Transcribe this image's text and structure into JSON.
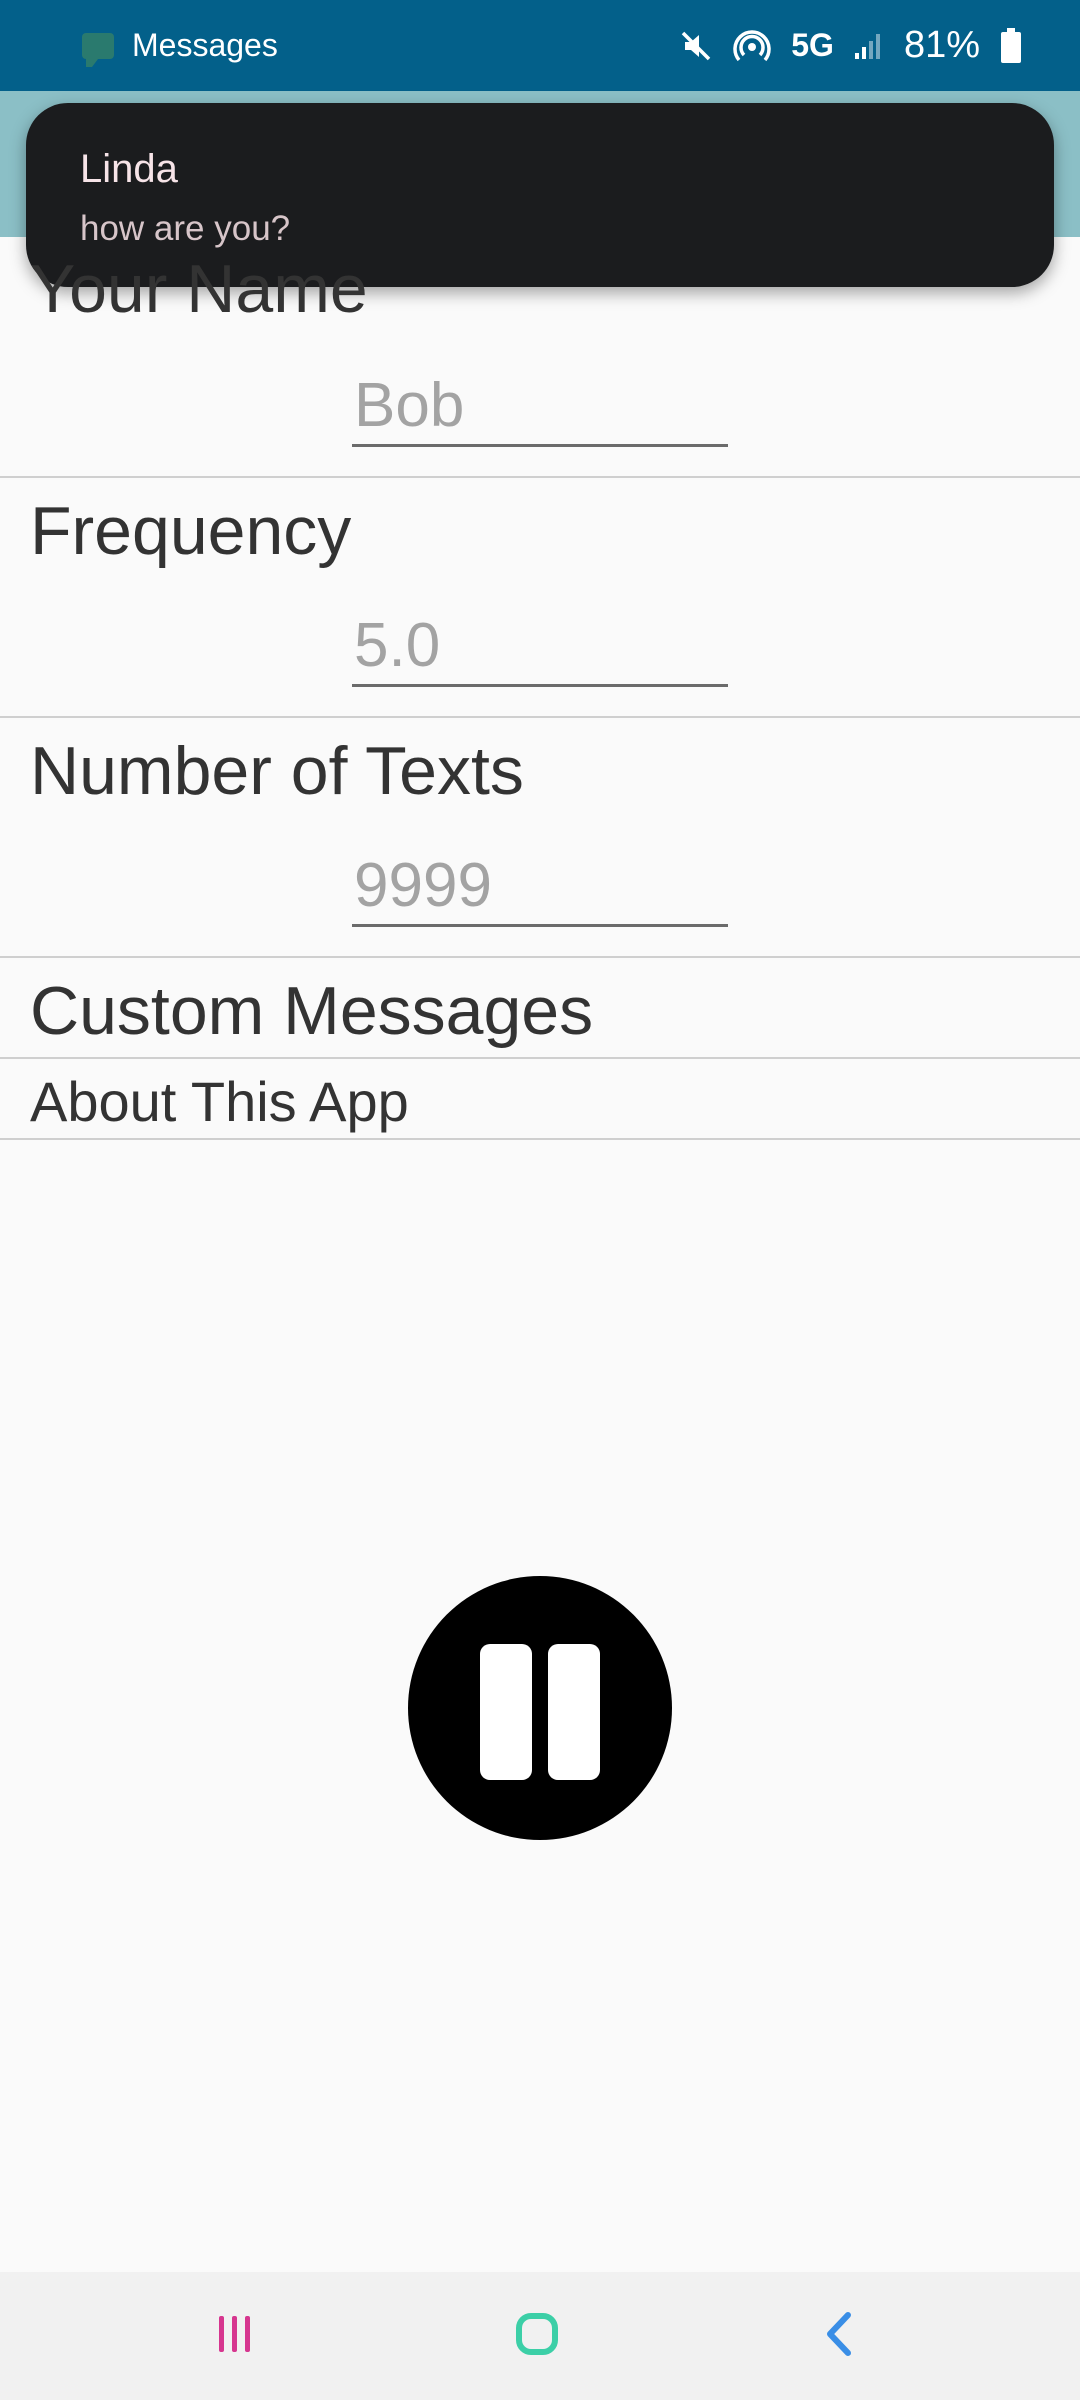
{
  "status_bar": {
    "app_label": "Messages",
    "network": "5G",
    "battery": "81%",
    "icons": [
      "messages-app-icon",
      "mute-icon",
      "hotspot-icon",
      "signal-icon",
      "battery-icon"
    ]
  },
  "notification": {
    "title": "Linda",
    "body": "how are you?"
  },
  "preferences": {
    "name": {
      "title": "Your Name",
      "placeholder": "Bob"
    },
    "frequency": {
      "title": "Frequency",
      "placeholder": "5.0"
    },
    "num_texts": {
      "title": "Number of Texts",
      "placeholder": "9999"
    },
    "custom_messages": {
      "title": "Custom Messages"
    },
    "about": {
      "title": "About This App"
    }
  },
  "controls": {
    "pause_icon": "pause-icon"
  },
  "nav": {
    "icons": [
      "recents-icon",
      "home-icon",
      "back-icon"
    ]
  },
  "colors": {
    "status_bar": "#03608a",
    "toolbar": "#8bbfc6",
    "notification_bg": "#1b1c1e",
    "background": "#fafafa"
  }
}
